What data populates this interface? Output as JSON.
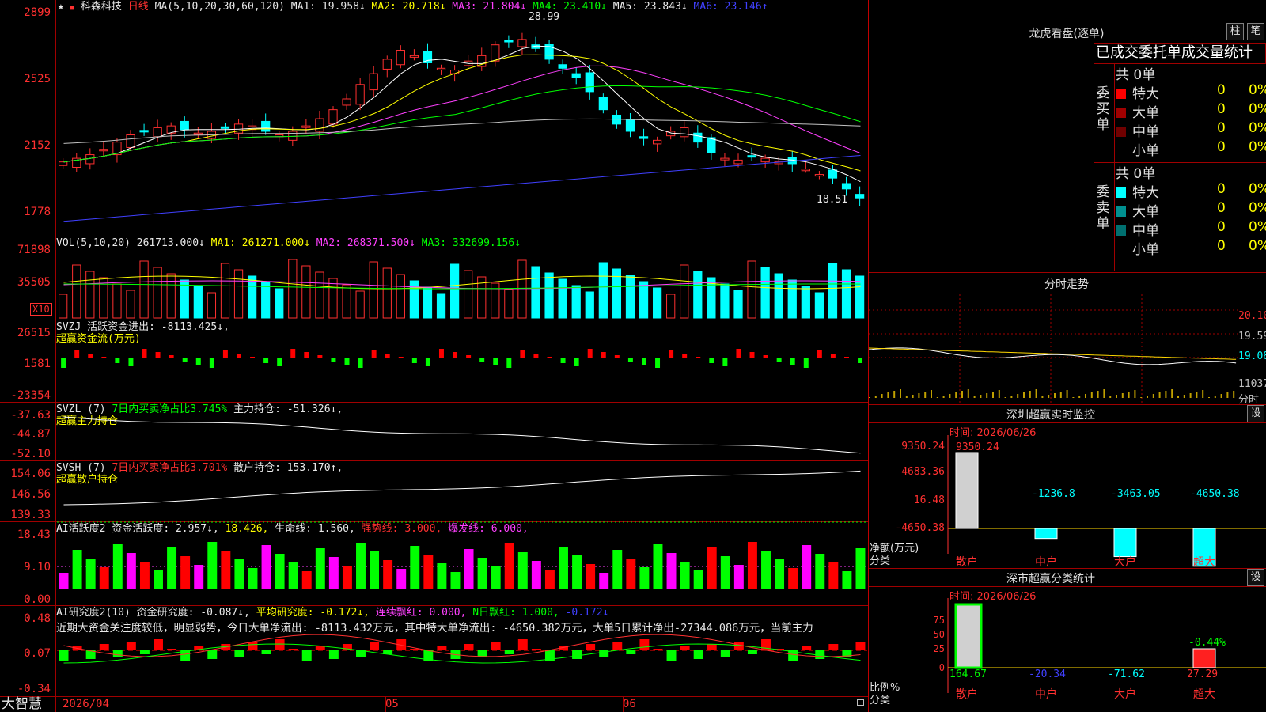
{
  "stock": {
    "name": "科森科技",
    "period": "日线",
    "title_prefix": "★"
  },
  "main_chart": {
    "ma_header": "MA(5,10,20,30,60,120)",
    "ma1": "MA1: 19.958↓",
    "ma2": "MA2: 20.718↓",
    "ma3": "MA3: 21.804↓",
    "ma4": "MA4: 23.410↓",
    "ma5": "MA5: 23.843↓",
    "ma6": "MA6: 23.146↑",
    "y_labels": [
      "2899",
      "2525",
      "2152",
      "1778"
    ],
    "high_mark": "28.99",
    "low_mark": "18.51"
  },
  "volume": {
    "header": "VOL(5,10,20)",
    "value": "261713.000↓",
    "ma1": "MA1: 261271.000↓",
    "ma2": "MA2: 268371.500↓",
    "ma3": "MA3: 332699.156↓",
    "y_labels": [
      "71898",
      "35505"
    ],
    "unit": "X10"
  },
  "svzj": {
    "name": "SVZJ",
    "label": "活跃资金进出: -8113.425↓,",
    "sub": "超赢资金流(万元)",
    "y_labels": [
      "26515",
      "1581",
      "-23354"
    ]
  },
  "svzl": {
    "name": "SVZL (7)",
    "label1": "7日内买卖净占比3.745%",
    "label2": "主力持仓: -51.326↓,",
    "sub": "超赢主力持仓",
    "y_labels": [
      "-37.63",
      "-44.87",
      "-52.10"
    ]
  },
  "svsh": {
    "name": "SVSH (7)",
    "label1": "7日内买卖净占比3.701%",
    "label2": "散户持仓: 153.170↑,",
    "sub": "超赢散户持仓",
    "y_labels": [
      "154.06",
      "146.56",
      "139.33"
    ]
  },
  "ai_active": {
    "name": "AI活跃度2",
    "v1": "资金活跃度: 2.957↓,",
    "v2": "18.426,",
    "v3": "生命线: 1.560,",
    "v4": "强势线: 3.000,",
    "v5": "爆发线: 6.000,",
    "y_labels": [
      "18.43",
      "9.10",
      "0.00"
    ]
  },
  "ai_research": {
    "name": "AI研究度2(10)",
    "v1": "资金研究度: -0.087↓,",
    "v2": "平均研究度: -0.172↓,",
    "v3": "连续飘红: 0.000,",
    "v4": "N日飘红: 1.000,",
    "v5": "-0.172↓",
    "comment": "近期大资金关注度较低，明显弱势，今日大单净流出: -8113.432万元，其中特大单净流出: -4650.382万元，大单5日累计净出-27344.086万元，当前主力",
    "y_labels": [
      "0.48",
      "0.07",
      "-0.34"
    ]
  },
  "footer": {
    "app": "大智慧",
    "date": "2026/04",
    "month5": "05",
    "month6": "06"
  },
  "lhb": {
    "title": "龙虎看盘(逐单)",
    "btn_col": "柱",
    "btn_pen": "笔",
    "tab_title": "已成交委托单成交量统计",
    "buy_group": "委买单",
    "sell_group": "委卖单",
    "buy_total": "共 0单",
    "sell_total": "共 0单",
    "buy_rows": [
      {
        "label": "特大",
        "count": "0",
        "pct": "0%",
        "color": "#ff0000"
      },
      {
        "label": "大单",
        "count": "0",
        "pct": "0%",
        "color": "#a00000"
      },
      {
        "label": "中单",
        "count": "0",
        "pct": "0%",
        "color": "#700000"
      },
      {
        "label": "小单",
        "count": "0",
        "pct": "0%",
        "color": "#000000"
      }
    ],
    "sell_rows": [
      {
        "label": "特大",
        "count": "0",
        "pct": "0%",
        "color": "#00ffff"
      },
      {
        "label": "大单",
        "count": "0",
        "pct": "0%",
        "color": "#009090"
      },
      {
        "label": "中单",
        "count": "0",
        "pct": "0%",
        "color": "#007070"
      },
      {
        "label": "小单",
        "count": "0",
        "pct": "0%",
        "color": "#000000"
      }
    ]
  },
  "intraday": {
    "title": "分时走势",
    "price_labels": [
      "20.10",
      "19.59",
      "19.08"
    ],
    "vol_label": "11037",
    "vol_unit": "分时"
  },
  "sz_monitor": {
    "title": "深圳超赢实时监控",
    "btn": "设",
    "time": "时间: 2026/06/26",
    "y_labels": [
      "9350.24",
      "4683.36",
      "16.48",
      "-4650.38"
    ],
    "y_unit": "净额(万元)",
    "x_unit": "分类",
    "categories": [
      "散户",
      "中户",
      "大户",
      "超大"
    ],
    "bar_labels": [
      "9350.24",
      "-1236.8",
      "-3463.05",
      "-4650.38"
    ]
  },
  "sz_class": {
    "title": "深市超赢分类统计",
    "btn": "设",
    "time": "时间: 2026/06/26",
    "y_labels": [
      "75",
      "50",
      "25",
      "0"
    ],
    "y_unit": "比例%",
    "x_unit": "分类",
    "categories": [
      "散户",
      "中户",
      "大户",
      "超大"
    ],
    "bottom_labels": [
      "164.67",
      "-20.34",
      "-71.62",
      "27.29"
    ],
    "top_label": "-0.44%"
  },
  "chart_data": {
    "type": "bar",
    "title": "深圳超赢实时监控",
    "ylabel": "净额(万元)",
    "categories": [
      "散户",
      "中户",
      "大户",
      "超大"
    ],
    "values": [
      9350.24,
      -1236.8,
      -3463.05,
      -4650.38
    ],
    "ylim": [
      -4650.38,
      9350.24
    ]
  }
}
